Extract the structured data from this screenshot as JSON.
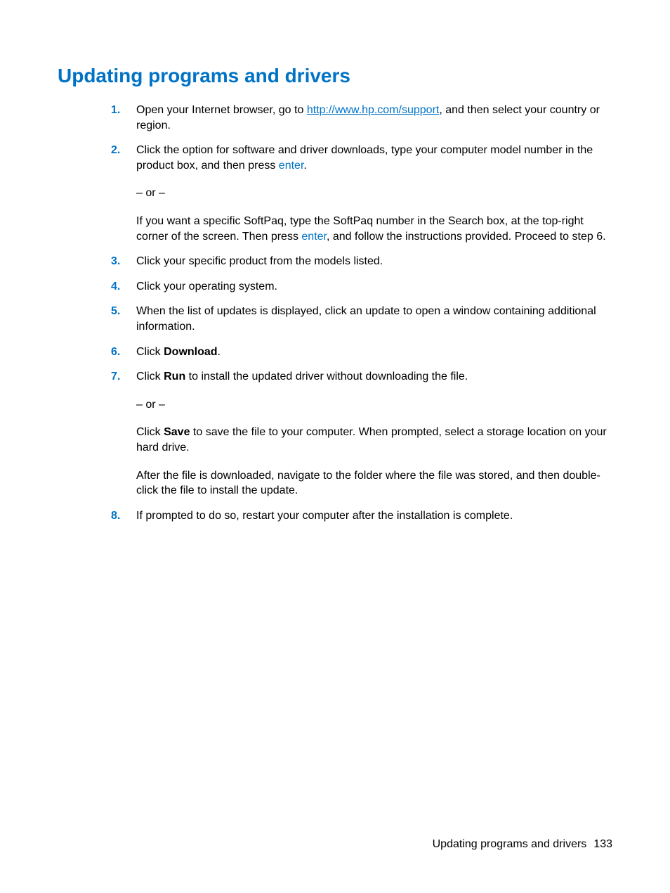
{
  "heading": "Updating programs and drivers",
  "steps": {
    "s1": {
      "num": "1.",
      "pre": "Open your Internet browser, go to ",
      "link": "http://www.hp.com/support",
      "post": ", and then select your country or region."
    },
    "s2": {
      "num": "2.",
      "p1_pre": "Click the option for software and driver downloads, type your computer model number in the product box, and then press ",
      "p1_kw": "enter",
      "p1_post": ".",
      "p2": "– or –",
      "p3_pre": "If you want a specific SoftPaq, type the SoftPaq number in the Search box, at the top-right corner of the screen. Then press ",
      "p3_kw": "enter",
      "p3_post": ", and follow the instructions provided. Proceed to step 6."
    },
    "s3": {
      "num": "3.",
      "text": "Click your specific product from the models listed."
    },
    "s4": {
      "num": "4.",
      "text": "Click your operating system."
    },
    "s5": {
      "num": "5.",
      "text": "When the list of updates is displayed, click an update to open a window containing additional information."
    },
    "s6": {
      "num": "6.",
      "pre": "Click ",
      "bold": "Download",
      "post": "."
    },
    "s7": {
      "num": "7.",
      "p1_pre": "Click ",
      "p1_bold": "Run",
      "p1_post": " to install the updated driver without downloading the file.",
      "p2": "– or –",
      "p3_pre": "Click ",
      "p3_bold": "Save",
      "p3_post": " to save the file to your computer. When prompted, select a storage location on your hard drive.",
      "p4": "After the file is downloaded, navigate to the folder where the file was stored, and then double-click the file to install the update."
    },
    "s8": {
      "num": "8.",
      "text": "If prompted to do so, restart your computer after the installation is complete."
    }
  },
  "footer": {
    "text": "Updating programs and drivers",
    "page": "133"
  }
}
